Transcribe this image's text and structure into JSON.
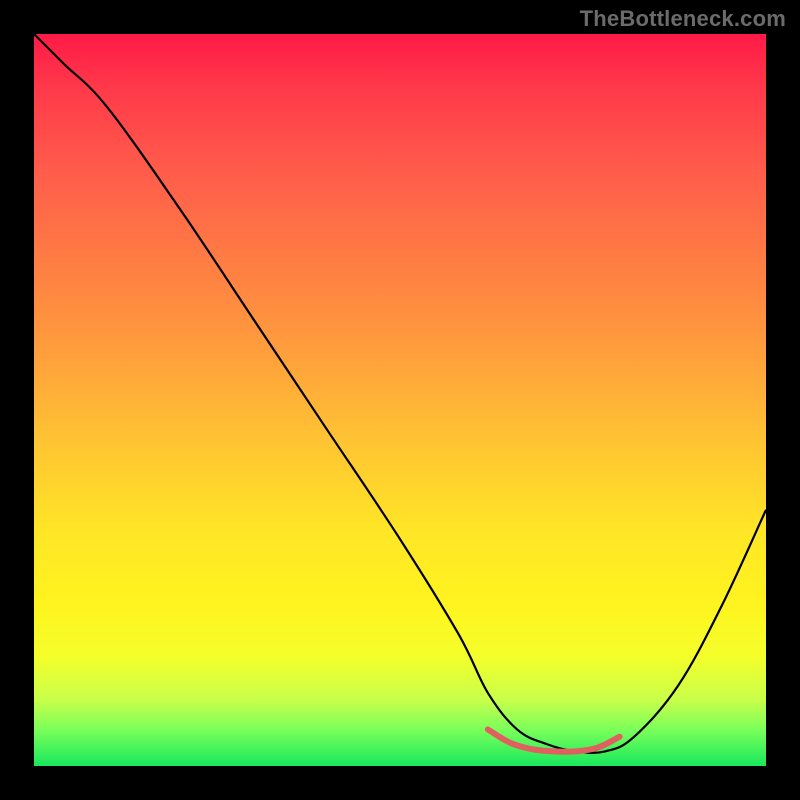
{
  "watermark": "TheBottleneck.com",
  "chart_data": {
    "type": "line",
    "title": "",
    "xlabel": "",
    "ylabel": "",
    "xlim": [
      0,
      100
    ],
    "ylim": [
      0,
      100
    ],
    "grid": false,
    "series": [
      {
        "name": "black-curve",
        "color": "#000000",
        "width": 2.2,
        "x": [
          0,
          4,
          10,
          20,
          30,
          40,
          50,
          58,
          62,
          66,
          70,
          74,
          78,
          82,
          88,
          94,
          100
        ],
        "y": [
          100,
          96,
          90,
          76,
          61,
          46,
          31,
          18,
          10,
          5,
          3,
          2,
          2,
          4,
          11,
          22,
          35
        ]
      },
      {
        "name": "red-segment",
        "color": "#e06060",
        "width": 6,
        "x": [
          62,
          65,
          68,
          71,
          74,
          77,
          80
        ],
        "y": [
          5,
          3.2,
          2.3,
          2,
          2,
          2.5,
          4
        ]
      }
    ],
    "annotations": []
  }
}
